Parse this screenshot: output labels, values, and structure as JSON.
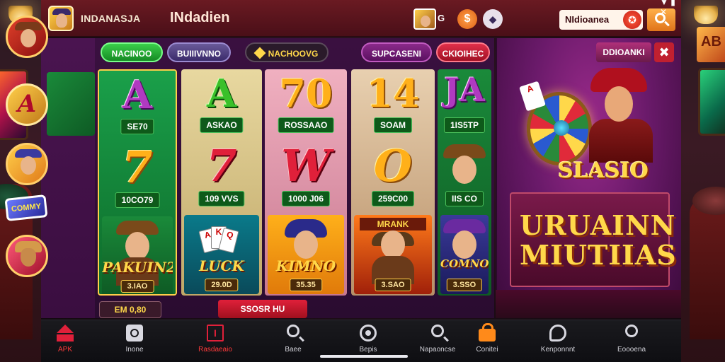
{
  "app": {
    "name": "INDANASJA",
    "title": "INdadien"
  },
  "header": {
    "user_badge": "G",
    "coin_glyph": "$",
    "diamond_glyph": "◆",
    "search_text": "NIdioanea",
    "search_badge_glyph": "✪",
    "status_icons": "▼ ▮ ✕"
  },
  "filters": [
    {
      "label": "NACINOO"
    },
    {
      "label": "BUIIIVNNO"
    },
    {
      "label": "NACHOOVG"
    },
    {
      "label": "SUPCASENI"
    },
    {
      "label": "CKIOIHEC"
    }
  ],
  "side_rail": {
    "rail_glyph": "A",
    "tag_label": "COMMY"
  },
  "columns": [
    {
      "sym_top": "A",
      "tag_a": "SE70",
      "sym_mid": "7",
      "tag_b": "10CO79",
      "card_title": "PAKUIN2",
      "price": "3.IAO"
    },
    {
      "sym_top": "A",
      "tag_a": "ASKAO",
      "sym_mid": "7",
      "tag_b": "109 VVS",
      "card_title": "LUCK",
      "price": "29.0D"
    },
    {
      "sym_top": "70",
      "tag_a": "ROSSAAO",
      "sym_mid": "W",
      "tag_b": "1000 J06",
      "card_title": "KIMNO",
      "price": "35.35"
    },
    {
      "sym_top": "14",
      "tag_a": "SOAM",
      "sym_mid": "O",
      "tag_b": "259C00",
      "card_title": "MRANK",
      "price": "3.SAO"
    },
    {
      "sym_top": "JA",
      "tag_a": "1IS5TP",
      "sym_mid": "",
      "tag_b": "IIS CO",
      "card_title": "COMNO",
      "price": "3.SSO"
    }
  ],
  "bottom_chips": {
    "left": "EM 0,80",
    "center": "SSOSR HU"
  },
  "promo": {
    "chip_label": "DDIOANKI",
    "close_glyph": "✖",
    "card_glyph": "A",
    "logo": "SLASIO",
    "headline_line1": "URUAINN",
    "headline_line2": "MIUTIIAS"
  },
  "bottom_nav": [
    {
      "label": "APK"
    },
    {
      "label": "Inone"
    },
    {
      "label": "Rasdaeaio"
    },
    {
      "label": "Baee"
    },
    {
      "label": "Bepis"
    },
    {
      "label": "Napaoncse"
    },
    {
      "label": "Conitei"
    },
    {
      "label": "Kenponnnt"
    },
    {
      "label": "Eoooena"
    }
  ]
}
